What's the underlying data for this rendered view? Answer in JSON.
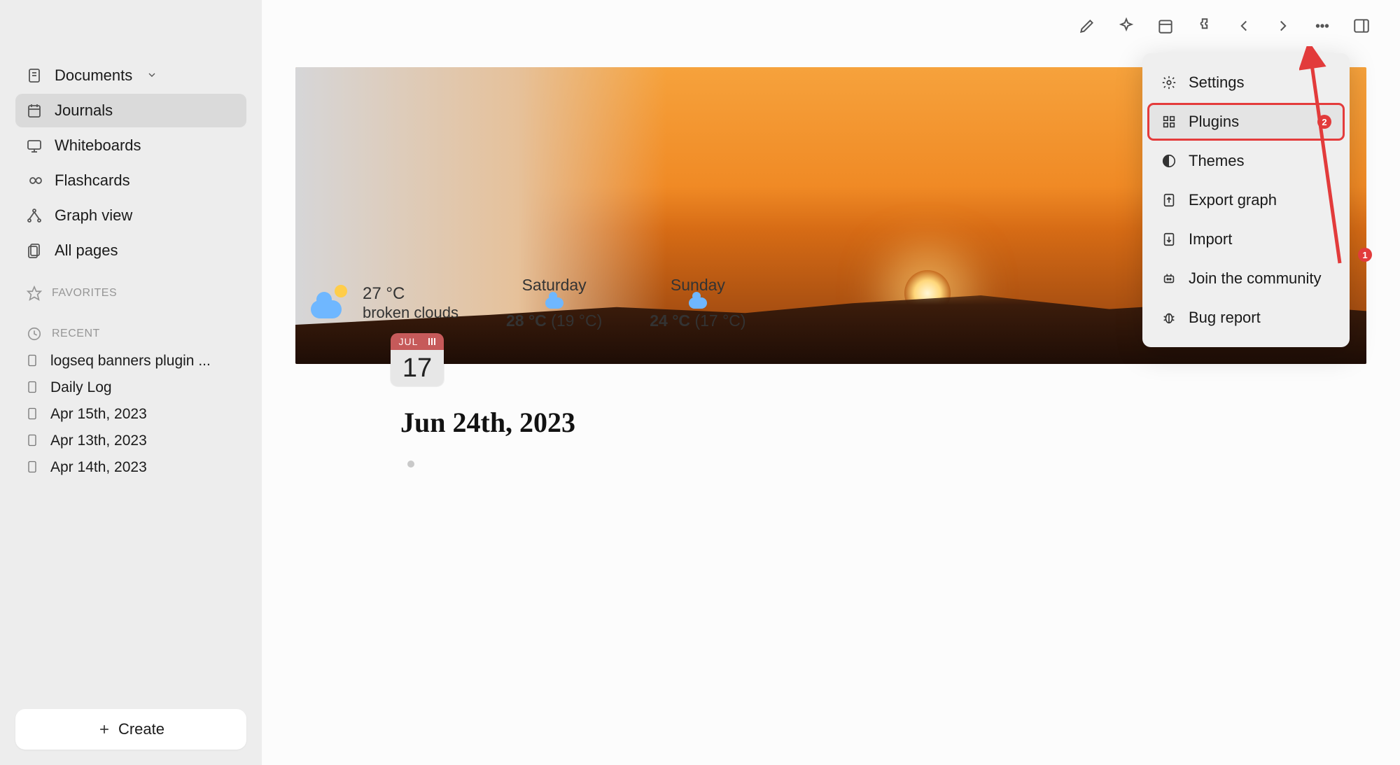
{
  "sidebar": {
    "nav": [
      {
        "label": "Documents",
        "icon": "documents",
        "chevron": true
      },
      {
        "label": "Journals",
        "icon": "calendar",
        "active": true
      },
      {
        "label": "Whiteboards",
        "icon": "whiteboard"
      },
      {
        "label": "Flashcards",
        "icon": "infinity"
      },
      {
        "label": "Graph view",
        "icon": "graph"
      },
      {
        "label": "All pages",
        "icon": "pages"
      }
    ],
    "favorites_label": "FAVORITES",
    "recent_label": "RECENT",
    "recent": [
      "logseq banners plugin ...",
      "Daily Log",
      "Apr 15th, 2023",
      "Apr 13th, 2023",
      "Apr 14th, 2023"
    ],
    "create_label": "Create"
  },
  "page": {
    "title": "Jun 24th, 2023"
  },
  "date_chip": {
    "month": "JUL",
    "day": "17"
  },
  "weather": {
    "today": {
      "temp": "27 °C",
      "desc": "broken clouds"
    },
    "days": [
      {
        "name": "Saturday",
        "hi": "28 °C",
        "lo": "(19 °C)"
      },
      {
        "name": "Sunday",
        "hi": "24 °C",
        "lo": "(17 °C)"
      }
    ]
  },
  "menu": {
    "items": [
      {
        "label": "Settings",
        "icon": "gear"
      },
      {
        "label": "Plugins",
        "icon": "plugins",
        "highlight": true,
        "badge": "2"
      },
      {
        "label": "Themes",
        "icon": "themes"
      },
      {
        "label": "Export graph",
        "icon": "export"
      },
      {
        "label": "Import",
        "icon": "import"
      },
      {
        "label": "Join the community",
        "icon": "community"
      },
      {
        "label": "Bug report",
        "icon": "bug"
      }
    ]
  },
  "annotations": {
    "arrow_badge": "1"
  }
}
